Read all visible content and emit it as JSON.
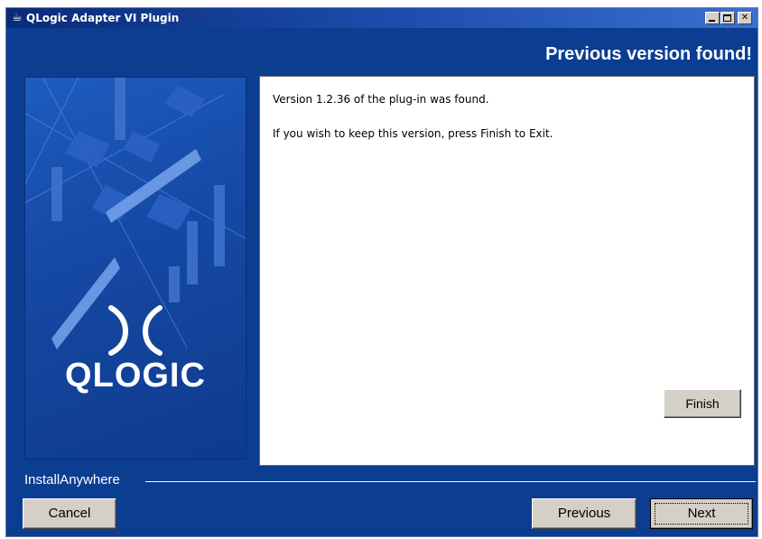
{
  "window": {
    "title": "QLogic Adapter VI Plugin",
    "title_icon": "java-cup-icon",
    "controls": [
      "minimize-icon",
      "maximize-icon",
      "close-icon"
    ]
  },
  "header": {
    "title": "Previous version found!"
  },
  "side_panel": {
    "logo_text": "QLOGIC"
  },
  "content": {
    "message_1": "Version 1.2.36 of the plug-in was found.",
    "message_2": "If you wish to keep this version, press Finish to Exit.",
    "finish_label": "Finish"
  },
  "footer": {
    "installer_label": "InstallAnywhere",
    "cancel_label": "Cancel",
    "previous_label": "Previous",
    "next_label": "Next"
  },
  "colors": {
    "window_bg": "#0b3d91",
    "button_face": "#d4d0c8",
    "content_bg": "#ffffff"
  }
}
